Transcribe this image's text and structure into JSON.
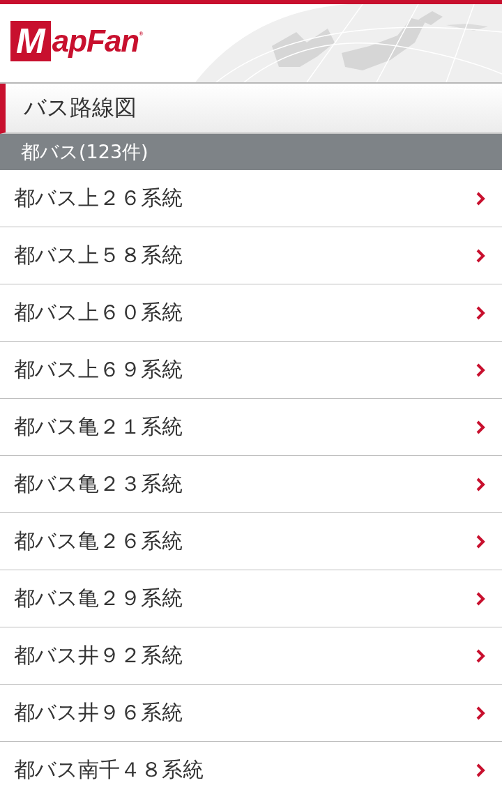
{
  "header": {
    "logo": {
      "initial": "M",
      "rest": "apFan",
      "mark": "®"
    }
  },
  "title": "バス路線図",
  "section": {
    "label": "都バス(123件)"
  },
  "items": [
    {
      "label": "都バス上２６系統"
    },
    {
      "label": "都バス上５８系統"
    },
    {
      "label": "都バス上６０系統"
    },
    {
      "label": "都バス上６９系統"
    },
    {
      "label": "都バス亀２１系統"
    },
    {
      "label": "都バス亀２３系統"
    },
    {
      "label": "都バス亀２６系統"
    },
    {
      "label": "都バス亀２９系統"
    },
    {
      "label": "都バス井９２系統"
    },
    {
      "label": "都バス井９６系統"
    },
    {
      "label": "都バス南千４８系統"
    }
  ]
}
